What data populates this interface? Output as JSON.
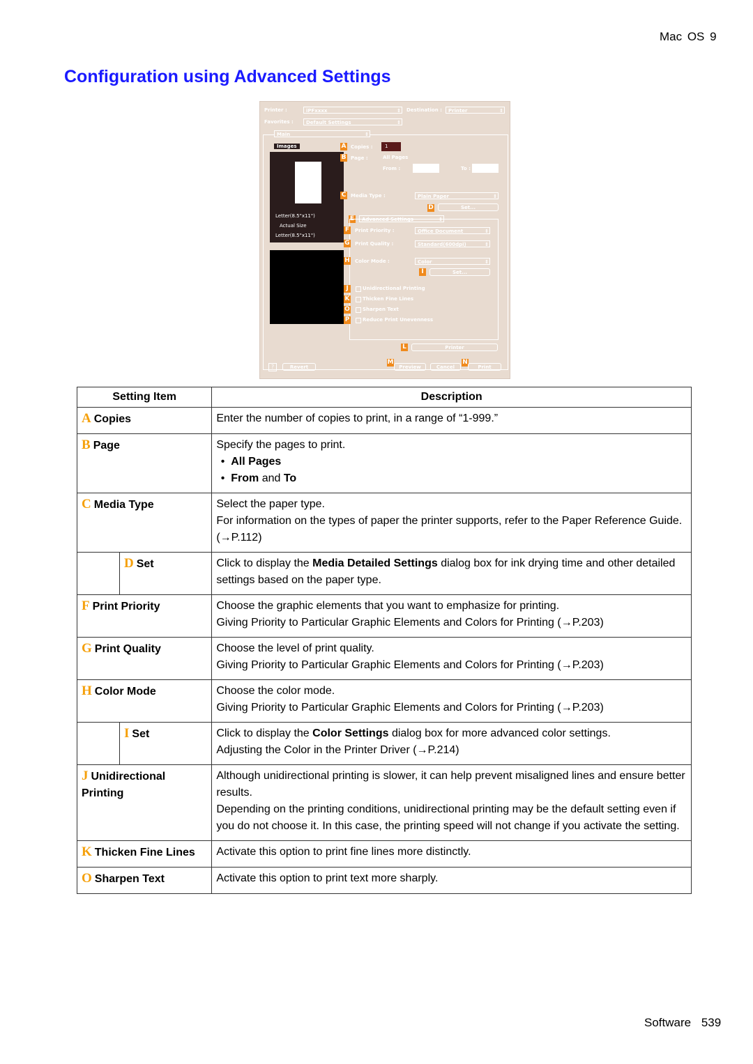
{
  "header": {
    "os_label": "Mac OS 9",
    "title": "Configuration using Advanced Settings"
  },
  "dialog": {
    "printer_label": "Printer :",
    "printer_value": "iPFxxxx",
    "destination_label": "Destination :",
    "destination_value": "Printer",
    "favorites_label": "Favorites :",
    "favorites_value": "Default Settings",
    "panel_value": "Main",
    "tab_images": "Images",
    "copies_label": "Copies :",
    "copies_value": "1",
    "page_label": "Page :",
    "all_pages": "All Pages",
    "from_label": "From :",
    "to_label": "To :",
    "paper_info_1": "Letter(8.5\"x11\")",
    "actual_size": "Actual Size",
    "paper_info_2": "Letter(8.5\"x11\")",
    "media_type_label": "Media Type :",
    "media_type_value": "Plain Paper",
    "set_button": "Set...",
    "advanced_settings": "Advanced Settings",
    "print_priority_label": "Print Priority :",
    "print_priority_value": "Office Document",
    "print_quality_label": "Print Quality :",
    "print_quality_value": "Standard(600dpi)",
    "color_mode_label": "Color Mode :",
    "color_mode_value": "Color",
    "color_set_button": "Set...",
    "checkboxes": [
      "Unidirectional Printing",
      "Thicken Fine Lines",
      "Sharpen Text",
      "Reduce Print Unevenness"
    ],
    "printer_button": "Printer",
    "revert_button": "Revert",
    "preview_button": "Preview",
    "cancel_button": "Cancel",
    "print_button": "Print",
    "badges": [
      "A",
      "B",
      "C",
      "D",
      "E",
      "F",
      "G",
      "H",
      "I",
      "J",
      "K",
      "O",
      "P",
      "L",
      "M",
      "N"
    ]
  },
  "table": {
    "col_setting": "Setting Item",
    "col_description": "Description",
    "rows": [
      {
        "letter": "A",
        "item": "Copies",
        "lines": [
          "Enter the number of copies to print, in a range of “1-999.”"
        ]
      },
      {
        "letter": "B",
        "item": "Page",
        "lines": [
          "Specify the pages to print."
        ],
        "bullets": [
          "All Pages",
          "From and To"
        ]
      },
      {
        "letter": "C",
        "item": "Media Type",
        "lines": [
          "Select the paper type.",
          "For information on the types of paper the printer supports, refer to the Paper Reference Guide. (→P.112)"
        ]
      },
      {
        "letter": "D",
        "item": "Set",
        "sub": true,
        "pre": "Click to display the ",
        "bold": "Media Detailed Settings",
        "post": " dialog box for ink drying time and other detailed settings based on the paper type."
      },
      {
        "letter": "F",
        "item": "Print Priority",
        "lines": [
          "Choose the graphic elements that you want to emphasize for printing.",
          "Giving Priority to Particular Graphic Elements and Colors for Printing (→P.203)"
        ]
      },
      {
        "letter": "G",
        "item": "Print Quality",
        "lines": [
          "Choose the level of print quality.",
          "Giving Priority to Particular Graphic Elements and Colors for Printing (→P.203)"
        ]
      },
      {
        "letter": "H",
        "item": "Color Mode",
        "lines": [
          "Choose the color mode.",
          "Giving Priority to Particular Graphic Elements and Colors for Printing (→P.203)"
        ]
      },
      {
        "letter": "I",
        "item": "Set",
        "sub": true,
        "pre": "Click to display the ",
        "bold": "Color Settings",
        "post": " dialog box for more advanced color settings.",
        "extra": "Adjusting the Color in the Printer Driver (→P.214)"
      },
      {
        "letter": "J",
        "item": "Unidirectional Printing",
        "lines": [
          "Although unidirectional printing is slower, it can help prevent misaligned lines and ensure better results.",
          "Depending on the printing conditions, unidirectional printing may be the default setting even if you do not choose it. In this case, the printing speed will not change if you activate the setting."
        ]
      },
      {
        "letter": "K",
        "item": "Thicken Fine Lines",
        "lines": [
          "Activate this option to print fine lines more distinctly."
        ]
      },
      {
        "letter": "O",
        "item": "Sharpen Text",
        "lines": [
          "Activate this option to print text more sharply."
        ]
      }
    ]
  },
  "footer": {
    "section": "Software",
    "page": "539"
  }
}
